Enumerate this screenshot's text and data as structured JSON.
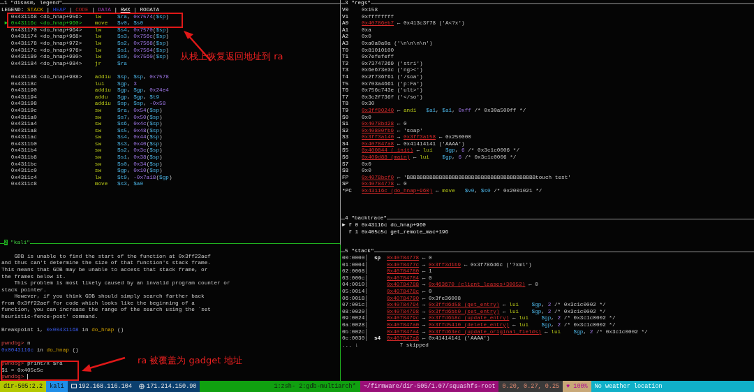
{
  "disasm": {
    "number": "1",
    "title": "\"disasm, legend\"",
    "legend": [
      {
        "kind": "white",
        "text": "LEGEND: "
      },
      {
        "kind": "stack",
        "text": "STACK"
      },
      {
        "kind": "white",
        "text": " | "
      },
      {
        "kind": "heap",
        "text": "HEAP"
      },
      {
        "kind": "white",
        "text": " | "
      },
      {
        "kind": "code",
        "text": "CODE"
      },
      {
        "kind": "white",
        "text": " | "
      },
      {
        "kind": "data",
        "text": "DATA"
      },
      {
        "kind": "white",
        "text": " | "
      },
      {
        "kind": "rwx",
        "text": "RWX"
      },
      {
        "kind": "white",
        "text": " | RODATA"
      }
    ],
    "blocks": [
      [
        {
          "addr": "0x431168",
          "label": "<do_hnap+956>",
          "current": false,
          "op": "lw",
          "args": [
            {
              "kind": "reg",
              "text": "$ra"
            },
            {
              "text": ", "
            },
            {
              "kind": "num",
              "text": "0x7574"
            },
            {
              "text": "("
            },
            {
              "kind": "reg",
              "text": "$sp"
            },
            {
              "text": ")"
            }
          ]
        },
        {
          "addr": "0x43116c",
          "label": "<do_hnap+960>",
          "current": true,
          "marker": "►",
          "op": "move",
          "args": [
            {
              "kind": "reg",
              "text": "$v0"
            },
            {
              "text": ", "
            },
            {
              "kind": "reg",
              "text": "$s0"
            }
          ]
        },
        {
          "addr": "0x431170",
          "label": "<do_hnap+964>",
          "current": false,
          "op": "lw",
          "args": [
            {
              "kind": "reg",
              "text": "$s4"
            },
            {
              "text": ", "
            },
            {
              "kind": "num",
              "text": "0x7570"
            },
            {
              "text": "("
            },
            {
              "kind": "reg",
              "text": "$sp"
            },
            {
              "text": ")"
            }
          ]
        },
        {
          "addr": "0x431174",
          "label": "<do_hnap+968>",
          "current": false,
          "op": "lw",
          "args": [
            {
              "kind": "reg",
              "text": "$s3"
            },
            {
              "text": ", "
            },
            {
              "kind": "num",
              "text": "0x756c"
            },
            {
              "text": "("
            },
            {
              "kind": "reg",
              "text": "$sp"
            },
            {
              "text": ")"
            }
          ]
        },
        {
          "addr": "0x431178",
          "label": "<do_hnap+972>",
          "current": false,
          "op": "lw",
          "args": [
            {
              "kind": "reg",
              "text": "$s2"
            },
            {
              "text": ", "
            },
            {
              "kind": "num",
              "text": "0x7568"
            },
            {
              "text": "("
            },
            {
              "kind": "reg",
              "text": "$sp"
            },
            {
              "text": ")"
            }
          ]
        },
        {
          "addr": "0x43117c",
          "label": "<do_hnap+976>",
          "current": false,
          "op": "lw",
          "args": [
            {
              "kind": "reg",
              "text": "$s1"
            },
            {
              "text": ", "
            },
            {
              "kind": "num",
              "text": "0x7564"
            },
            {
              "text": "("
            },
            {
              "kind": "reg",
              "text": "$sp"
            },
            {
              "text": ")"
            }
          ]
        },
        {
          "addr": "0x431180",
          "label": "<do_hnap+980>",
          "current": false,
          "op": "lw",
          "args": [
            {
              "kind": "reg",
              "text": "$s0"
            },
            {
              "text": ", "
            },
            {
              "kind": "num",
              "text": "0x7560"
            },
            {
              "text": "("
            },
            {
              "kind": "reg",
              "text": "$sp"
            },
            {
              "text": ")"
            }
          ]
        },
        {
          "addr": "0x431184",
          "label": "<do_hnap+984>",
          "current": false,
          "op": "jr",
          "args": [
            {
              "kind": "reg",
              "text": "$ra"
            }
          ]
        }
      ],
      [
        {
          "addr": "0x431188",
          "label": "<do_hnap+988>",
          "current": false,
          "op": "addiu",
          "args": [
            {
              "kind": "reg",
              "text": "$sp"
            },
            {
              "text": ", "
            },
            {
              "kind": "reg",
              "text": "$sp"
            },
            {
              "text": ", "
            },
            {
              "kind": "num",
              "text": "0x7578"
            }
          ]
        },
        {
          "addr": "0x43118c",
          "current": false,
          "op": "lui",
          "args": [
            {
              "kind": "reg",
              "text": "$gp"
            },
            {
              "text": ", "
            },
            {
              "kind": "num",
              "text": "3"
            }
          ]
        },
        {
          "addr": "0x431190",
          "current": false,
          "op": "addiu",
          "args": [
            {
              "kind": "reg",
              "text": "$gp"
            },
            {
              "text": ", "
            },
            {
              "kind": "reg",
              "text": "$gp"
            },
            {
              "text": ", "
            },
            {
              "kind": "num",
              "text": "0x24e4"
            }
          ]
        },
        {
          "addr": "0x431194",
          "current": false,
          "op": "addu",
          "args": [
            {
              "kind": "reg",
              "text": "$gp"
            },
            {
              "text": ", "
            },
            {
              "kind": "reg",
              "text": "$gp"
            },
            {
              "text": ", "
            },
            {
              "kind": "reg",
              "text": "$t9"
            }
          ]
        },
        {
          "addr": "0x431198",
          "current": false,
          "op": "addiu",
          "args": [
            {
              "kind": "reg",
              "text": "$sp"
            },
            {
              "text": ", "
            },
            {
              "kind": "reg",
              "text": "$sp"
            },
            {
              "text": ", "
            },
            {
              "kind": "num",
              "text": "-0x58"
            }
          ]
        },
        {
          "addr": "0x43119c",
          "current": false,
          "op": "sw",
          "args": [
            {
              "kind": "reg",
              "text": "$ra"
            },
            {
              "text": ", "
            },
            {
              "kind": "num",
              "text": "0x54"
            },
            {
              "text": "("
            },
            {
              "kind": "reg",
              "text": "$sp"
            },
            {
              "text": ")"
            }
          ]
        },
        {
          "addr": "0x4311a0",
          "current": false,
          "op": "sw",
          "args": [
            {
              "kind": "reg",
              "text": "$s7"
            },
            {
              "text": ", "
            },
            {
              "kind": "num",
              "text": "0x50"
            },
            {
              "text": "("
            },
            {
              "kind": "reg",
              "text": "$sp"
            },
            {
              "text": ")"
            }
          ]
        },
        {
          "addr": "0x4311a4",
          "current": false,
          "op": "sw",
          "args": [
            {
              "kind": "reg",
              "text": "$s6"
            },
            {
              "text": ", "
            },
            {
              "kind": "num",
              "text": "0x4c"
            },
            {
              "text": "("
            },
            {
              "kind": "reg",
              "text": "$sp"
            },
            {
              "text": ")"
            }
          ]
        },
        {
          "addr": "0x4311a8",
          "current": false,
          "op": "sw",
          "args": [
            {
              "kind": "reg",
              "text": "$s5"
            },
            {
              "text": ", "
            },
            {
              "kind": "num",
              "text": "0x48"
            },
            {
              "text": "("
            },
            {
              "kind": "reg",
              "text": "$sp"
            },
            {
              "text": ")"
            }
          ]
        },
        {
          "addr": "0x4311ac",
          "current": false,
          "op": "sw",
          "args": [
            {
              "kind": "reg",
              "text": "$s4"
            },
            {
              "text": ", "
            },
            {
              "kind": "num",
              "text": "0x44"
            },
            {
              "text": "("
            },
            {
              "kind": "reg",
              "text": "$sp"
            },
            {
              "text": ")"
            }
          ]
        },
        {
          "addr": "0x4311b0",
          "current": false,
          "op": "sw",
          "args": [
            {
              "kind": "reg",
              "text": "$s3"
            },
            {
              "text": ", "
            },
            {
              "kind": "num",
              "text": "0x40"
            },
            {
              "text": "("
            },
            {
              "kind": "reg",
              "text": "$sp"
            },
            {
              "text": ")"
            }
          ]
        },
        {
          "addr": "0x4311b4",
          "current": false,
          "op": "sw",
          "args": [
            {
              "kind": "reg",
              "text": "$s2"
            },
            {
              "text": ", "
            },
            {
              "kind": "num",
              "text": "0x3c"
            },
            {
              "text": "("
            },
            {
              "kind": "reg",
              "text": "$sp"
            },
            {
              "text": ")"
            }
          ]
        },
        {
          "addr": "0x4311b8",
          "current": false,
          "op": "sw",
          "args": [
            {
              "kind": "reg",
              "text": "$s1"
            },
            {
              "text": ", "
            },
            {
              "kind": "num",
              "text": "0x38"
            },
            {
              "text": "("
            },
            {
              "kind": "reg",
              "text": "$sp"
            },
            {
              "text": ")"
            }
          ]
        },
        {
          "addr": "0x4311bc",
          "current": false,
          "op": "sw",
          "args": [
            {
              "kind": "reg",
              "text": "$s0"
            },
            {
              "text": ", "
            },
            {
              "kind": "num",
              "text": "0x34"
            },
            {
              "text": "("
            },
            {
              "kind": "reg",
              "text": "$sp"
            },
            {
              "text": ")"
            }
          ]
        },
        {
          "addr": "0x4311c0",
          "current": false,
          "op": "sw",
          "args": [
            {
              "kind": "reg",
              "text": "$gp"
            },
            {
              "text": ", "
            },
            {
              "kind": "num",
              "text": "0x10"
            },
            {
              "text": "("
            },
            {
              "kind": "reg",
              "text": "$sp"
            },
            {
              "text": ")"
            }
          ]
        },
        {
          "addr": "0x4311c4",
          "current": false,
          "op": "lw",
          "args": [
            {
              "kind": "reg",
              "text": "$t9"
            },
            {
              "text": ", "
            },
            {
              "kind": "num",
              "text": "-0x7a18"
            },
            {
              "text": "("
            },
            {
              "kind": "reg",
              "text": "$gp"
            },
            {
              "text": ")"
            }
          ]
        },
        {
          "addr": "0x4311c8",
          "current": false,
          "op": "move",
          "args": [
            {
              "kind": "reg",
              "text": "$s3"
            },
            {
              "text": ", "
            },
            {
              "kind": "reg",
              "text": "$a0"
            }
          ]
        }
      ]
    ]
  },
  "kali": {
    "number": "2",
    "title": "\"kali\"",
    "blocks": [
      [
        [
          {
            "text": "    GDB is unable to find the start of the function at 0x3ff22aef"
          }
        ],
        [
          {
            "text": "and thus can't determine the size of that function's stack frame."
          }
        ],
        [
          {
            "text": "This means that GDB may be unable to access that stack frame, or"
          }
        ],
        [
          {
            "text": "the frames below it."
          }
        ],
        [
          {
            "text": "    This problem is most likely caused by an invalid program counter or"
          }
        ],
        [
          {
            "text": "stack pointer."
          }
        ],
        [
          {
            "text": "    However, if you think GDB should simply search farther back"
          }
        ],
        [
          {
            "text": "from 0x3ff22aef for code which looks like the beginning of a"
          }
        ],
        [
          {
            "text": "function, you can increase the range of the search using the `set"
          }
        ],
        [
          {
            "text": "heuristic-fence-post' command."
          }
        ]
      ],
      [
        [
          {
            "text": "Breakpoint 1, "
          },
          {
            "kind": "blue",
            "text": "0x00431168"
          },
          {
            "text": " in "
          },
          {
            "kind": "func",
            "text": "do_hnap"
          },
          {
            "text": " ()"
          }
        ]
      ],
      [
        [
          {
            "kind": "prompt",
            "text": "pwndbg> "
          },
          {
            "text": "n"
          }
        ],
        [
          {
            "kind": "blue",
            "text": "0x0043116c"
          },
          {
            "text": " in "
          },
          {
            "kind": "func",
            "text": "do_hnap"
          },
          {
            "text": " ()"
          }
        ]
      ],
      [
        [
          {
            "kind": "prompt",
            "text": "pwndbg> "
          },
          {
            "text": "print/x $ra"
          }
        ],
        [
          {
            "text": "$1 = 0x405c5c"
          }
        ],
        [
          {
            "kind": "prompt",
            "text": "pwndbg> "
          }
        ]
      ]
    ]
  },
  "regs": {
    "number": "3",
    "title": "\"regs\"",
    "rows": [
      {
        "name": "V0",
        "value": [
          {
            "text": "0x158"
          }
        ]
      },
      {
        "name": "V1",
        "value": [
          {
            "text": "0xffffffff"
          }
        ]
      },
      {
        "name": "A0",
        "value": [
          {
            "kind": "addr",
            "text": "0x40786eb7"
          },
          {
            "text": " ← 0x413c3f78 ('A<?x')"
          }
        ]
      },
      {
        "name": "A1",
        "value": [
          {
            "text": "0xa"
          }
        ]
      },
      {
        "name": "A2",
        "value": [
          {
            "text": "0x0"
          }
        ]
      },
      {
        "name": "A3",
        "value": [
          {
            "text": "0xa0a0a0a ('\\n\\n\\n\\n')"
          }
        ]
      },
      {
        "name": "T0",
        "value": [
          {
            "text": "0x81010100"
          }
        ]
      },
      {
        "name": "T1",
        "value": [
          {
            "text": "0x7efefeff"
          }
        ]
      },
      {
        "name": "T2",
        "value": [
          {
            "text": "0x73747269 ('stri')"
          }
        ]
      },
      {
        "name": "T3",
        "value": [
          {
            "text": "0x6e673e3c ('ng><')"
          }
        ]
      },
      {
        "name": "T4",
        "value": [
          {
            "text": "0x2f736f61 ('/soa')"
          }
        ]
      },
      {
        "name": "T5",
        "value": [
          {
            "text": "0x703a4661 ('p:Fa')"
          }
        ]
      },
      {
        "name": "T6",
        "value": [
          {
            "text": "0x756c743e ('ult>')"
          }
        ]
      },
      {
        "name": "T7",
        "value": [
          {
            "text": "0x3c2f736f ('</so')"
          }
        ]
      },
      {
        "name": "T8",
        "value": [
          {
            "text": "0x30"
          }
        ]
      },
      {
        "name": "T9",
        "value": [
          {
            "kind": "addr",
            "text": "0x3ff00240"
          },
          {
            "text": " ← "
          },
          {
            "kind": "op",
            "text": "andi"
          },
          {
            "kind": "reg",
            "text": "$a1"
          },
          {
            "text": ", "
          },
          {
            "kind": "reg",
            "text": "$a1"
          },
          {
            "text": ", "
          },
          {
            "kind": "num",
            "text": "0xff"
          },
          {
            "text": " /* 0x30a500ff */"
          }
        ]
      },
      {
        "name": "S0",
        "value": [
          {
            "text": "0x0"
          }
        ]
      },
      {
        "name": "S1",
        "value": [
          {
            "kind": "addr",
            "text": "0x4078bd28"
          },
          {
            "text": " ← 0"
          }
        ]
      },
      {
        "name": "S2",
        "value": [
          {
            "kind": "addr",
            "text": "0x40800fb9"
          },
          {
            "text": " ← 'soap'"
          }
        ]
      },
      {
        "name": "S3",
        "value": [
          {
            "kind": "addr",
            "text": "0x3ff3a140"
          },
          {
            "text": " → "
          },
          {
            "kind": "addr",
            "text": "0x3ff3a158"
          },
          {
            "text": " ← 0x250000"
          }
        ]
      },
      {
        "name": "S4",
        "value": [
          {
            "kind": "addr",
            "text": "0x407847a8"
          },
          {
            "text": " ← 0x41414141 ('AAAA')"
          }
        ]
      },
      {
        "name": "S5",
        "value": [
          {
            "kind": "addr",
            "text": "0x400844 (_init)"
          },
          {
            "text": " ← "
          },
          {
            "kind": "op",
            "text": "lui"
          },
          {
            "kind": "reg",
            "text": "$gp"
          },
          {
            "text": ", "
          },
          {
            "kind": "num",
            "text": "6"
          },
          {
            "text": " /* 0x3c1c0006 */"
          }
        ]
      },
      {
        "name": "S6",
        "value": [
          {
            "kind": "addr",
            "text": "0x409d88 (main)"
          },
          {
            "text": " ← "
          },
          {
            "kind": "op",
            "text": "lui"
          },
          {
            "kind": "reg",
            "text": "$gp"
          },
          {
            "text": ", "
          },
          {
            "kind": "num",
            "text": "6"
          },
          {
            "text": " /* 0x3c1c0006 */"
          }
        ]
      },
      {
        "name": "S7",
        "value": [
          {
            "text": "0x0"
          }
        ]
      },
      {
        "name": "S8",
        "value": [
          {
            "text": "0x0"
          }
        ]
      },
      {
        "name": "FP",
        "value": [
          {
            "kind": "addr",
            "text": "0x4078bcf0"
          },
          {
            "text": " ← 'BBBBBBBBBBBBBBBBBBBBBBBBBBBBBBBBBBBBBBBBtouch test'"
          }
        ]
      },
      {
        "name": "SP",
        "value": [
          {
            "kind": "addr",
            "text": "0x40784778"
          },
          {
            "text": " ← 0"
          }
        ]
      },
      {
        "name": "*PC",
        "value": [
          {
            "kind": "addr",
            "text": "0x43116c (do_hnap+960)"
          },
          {
            "text": " ← "
          },
          {
            "kind": "op",
            "text": "move"
          },
          {
            "kind": "reg",
            "text": "$v0"
          },
          {
            "text": ", "
          },
          {
            "kind": "reg",
            "text": "$s0"
          },
          {
            "text": " /* 0x2001021 */"
          }
        ]
      }
    ]
  },
  "backtrace": {
    "number": "4",
    "title": "\"backtrace\"",
    "rows": [
      "► f 0 0x43116c do_hnap+960",
      "  f 1 0x405c5c get_remote_mac+196"
    ]
  },
  "stack": {
    "number": "5",
    "title": "\"stack\"",
    "rows": [
      {
        "offset": "00:0000│",
        "reg": "sp",
        "value": [
          {
            "kind": "addr",
            "text": "0x40784778"
          },
          {
            "text": " ← 0"
          }
        ]
      },
      {
        "offset": "01:0004│",
        "value": [
          {
            "kind": "addr",
            "text": "0x4078477c"
          },
          {
            "text": " → "
          },
          {
            "kind": "addr",
            "text": "0x3ff3d1b9"
          },
          {
            "text": " ← 0x3f786d6c ('?xml')"
          }
        ]
      },
      {
        "offset": "02:0008│",
        "value": [
          {
            "kind": "addr",
            "text": "0x40784780"
          },
          {
            "text": " ← 1"
          }
        ]
      },
      {
        "offset": "03:000c│",
        "value": [
          {
            "kind": "addr",
            "text": "0x40784784"
          },
          {
            "text": " ← 0"
          }
        ]
      },
      {
        "offset": "04:0010│",
        "value": [
          {
            "kind": "addr",
            "text": "0x40784788"
          },
          {
            "text": " → "
          },
          {
            "kind": "addr",
            "text": "0x463670 (client_leases+30052)"
          },
          {
            "text": " ← 0"
          }
        ]
      },
      {
        "offset": "05:0014│",
        "value": [
          {
            "kind": "addr",
            "text": "0x4078478c"
          },
          {
            "text": " ← 0"
          }
        ]
      },
      {
        "offset": "06:0018│",
        "value": [
          {
            "kind": "addr",
            "text": "0x40784790"
          },
          {
            "text": " ← 0x3fe36008"
          }
        ]
      },
      {
        "offset": "07:001c│",
        "value": [
          {
            "kind": "addr",
            "text": "0x40784794"
          },
          {
            "text": " → "
          },
          {
            "kind": "addr",
            "text": "0x3ffd6d58 (get_entry)"
          },
          {
            "text": " ← "
          },
          {
            "kind": "op",
            "text": "lui"
          },
          {
            "kind": "reg",
            "text": "$gp"
          },
          {
            "text": ", "
          },
          {
            "kind": "num",
            "text": "2"
          },
          {
            "text": " /* 0x3c1c0002 */"
          }
        ]
      },
      {
        "offset": "08:0020│",
        "value": [
          {
            "kind": "addr",
            "text": "0x40784798"
          },
          {
            "text": " → "
          },
          {
            "kind": "addr",
            "text": "0x3ffd6bb0 (set_entry)"
          },
          {
            "text": " ← "
          },
          {
            "kind": "op",
            "text": "lui"
          },
          {
            "kind": "reg",
            "text": "$gp"
          },
          {
            "text": ", "
          },
          {
            "kind": "num",
            "text": "2"
          },
          {
            "text": " /* 0x3c1c0002 */"
          }
        ]
      },
      {
        "offset": "09:0024│",
        "value": [
          {
            "kind": "addr",
            "text": "0x4078479c"
          },
          {
            "text": " → "
          },
          {
            "kind": "addr",
            "text": "0x3ffd6b8c (update_entry)"
          },
          {
            "text": " ← "
          },
          {
            "kind": "op",
            "text": "lui"
          },
          {
            "kind": "reg",
            "text": "$gp"
          },
          {
            "text": ", "
          },
          {
            "kind": "num",
            "text": "2"
          },
          {
            "text": " /* 0x3c1c0002 */"
          }
        ]
      },
      {
        "offset": "0a:0028│",
        "value": [
          {
            "kind": "addr",
            "text": "0x407847a0"
          },
          {
            "text": " → "
          },
          {
            "kind": "addr",
            "text": "0x3ffd5410 (delete_entry)"
          },
          {
            "text": " ← "
          },
          {
            "kind": "op",
            "text": "lui"
          },
          {
            "kind": "reg",
            "text": "$gp"
          },
          {
            "text": ", "
          },
          {
            "kind": "num",
            "text": "2"
          },
          {
            "text": " /* 0x3c1c0002 */"
          }
        ]
      },
      {
        "offset": "0b:002c│",
        "value": [
          {
            "kind": "addr",
            "text": "0x407847a4"
          },
          {
            "text": " → "
          },
          {
            "kind": "addr",
            "text": "0x3ffd63ec (update_original_fields)"
          },
          {
            "text": " ← "
          },
          {
            "kind": "op",
            "text": "lui"
          },
          {
            "kind": "reg",
            "text": "$gp"
          },
          {
            "text": ", "
          },
          {
            "kind": "num",
            "text": "2"
          },
          {
            "text": " /* 0x3c1c0002 */"
          }
        ]
      },
      {
        "offset": "0c:0030│",
        "reg": "s4",
        "value": [
          {
            "kind": "addr",
            "text": "0x407847a8"
          },
          {
            "text": " ← 0x41414141 ('AAAA')"
          }
        ]
      },
      {
        "offset": "... ↓",
        "value": [
          {
            "text": "    7 skipped"
          }
        ]
      }
    ]
  },
  "status_bar": {
    "left": [
      {
        "text": "dir-505:2.2",
        "kind": "session"
      },
      {
        "text": "kali",
        "kind": "host"
      },
      {
        "text": "192.168.116.104",
        "kind": "lan"
      },
      {
        "text": "171.214.150.90",
        "kind": "wan"
      }
    ],
    "windows": "1:zsh- 2:gdb-multiarch*",
    "right": [
      {
        "text": "~/firmware/dir-505/1.07/squashfs-root",
        "kind": "path"
      },
      {
        "text": "0.20, 0.27, 0.25",
        "kind": "load"
      },
      {
        "text": "♥ 100%",
        "kind": "battery"
      },
      {
        "text": "No weather location",
        "kind": "weather"
      }
    ]
  },
  "annotations": [
    "从栈上恢复返回地址到 ra",
    "ra 被覆盖为 gadget 地址"
  ]
}
